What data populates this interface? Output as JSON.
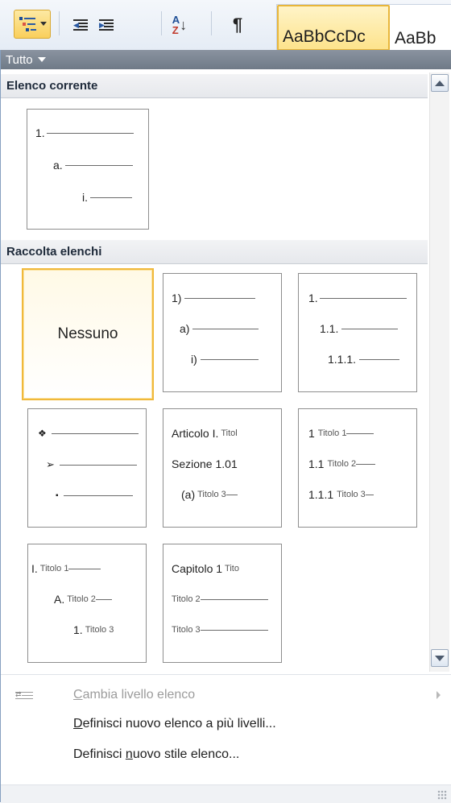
{
  "toolbar": {
    "multilevel_button": "multilevel-list-icon",
    "decrease_indent": "decrease-indent-icon",
    "increase_indent": "increase-indent-icon",
    "sort_az_top": "A",
    "sort_az_bottom": "Z",
    "sort_arrow": "↓",
    "show_marks": "¶",
    "style_tiles": [
      "AaBbCcDc",
      "AaBb"
    ]
  },
  "panel": {
    "filter_label": "Tutto",
    "section_current": "Elenco corrente",
    "section_library": "Raccolta elenchi",
    "current_list": {
      "rows": [
        "1.",
        "a.",
        "i."
      ]
    },
    "library": {
      "none_label": "Nessuno",
      "list_paren": [
        "1)",
        "a)",
        "i)"
      ],
      "list_decimal": [
        "1.",
        "1.1.",
        "1.1.1."
      ],
      "list_bullets": [
        "❖",
        "➢",
        "▪"
      ],
      "list_article": [
        {
          "lead": "Articolo I.",
          "tail": "Titol"
        },
        {
          "lead": "Sezione 1.01",
          "tail": ""
        },
        {
          "lead": "(a)",
          "tail": "Titolo 3"
        }
      ],
      "list_heading_numbered": [
        {
          "lead": "1",
          "tail": "Titolo 1"
        },
        {
          "lead": "1.1",
          "tail": "Titolo 2"
        },
        {
          "lead": "1.1.1",
          "tail": "Titolo 3"
        }
      ],
      "list_roman": [
        {
          "lead": "I.",
          "tail": "Titolo 1"
        },
        {
          "lead": "A.",
          "tail": "Titolo 2"
        },
        {
          "lead": "1.",
          "tail": "Titolo 3"
        }
      ],
      "list_chapter": [
        {
          "lead": "Capitolo 1",
          "tail": "Tito"
        },
        {
          "lead": "",
          "tail": "Titolo 2"
        },
        {
          "lead": "",
          "tail": "Titolo 3"
        }
      ]
    },
    "menu": {
      "change_level": {
        "pre": "",
        "mnemonic": "C",
        "post": "ambia livello elenco"
      },
      "define_multilevel": {
        "pre": "",
        "mnemonic": "D",
        "post": "efinisci nuovo elenco a più livelli..."
      },
      "define_style": {
        "pre": "Definisci ",
        "mnemonic": "n",
        "post": "uovo stile elenco..."
      }
    }
  }
}
